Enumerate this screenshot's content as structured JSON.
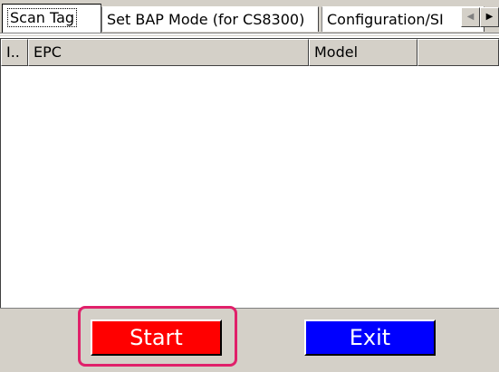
{
  "tabs": [
    {
      "label": "Scan Tag",
      "active": true
    },
    {
      "label": "Set BAP Mode (for CS8300)",
      "active": false
    },
    {
      "label": "Configuration/SI",
      "active": false
    }
  ],
  "tab_scroll": {
    "left_glyph": "◀",
    "right_glyph": "▶"
  },
  "list": {
    "columns": [
      "I..",
      "EPC",
      "Model",
      ""
    ],
    "rows": []
  },
  "buttons": {
    "start_label": "Start",
    "exit_label": "Exit"
  },
  "colors": {
    "start_bg": "#ff0000",
    "exit_bg": "#0000ff",
    "highlight": "#e0206a",
    "chrome": "#d4d0c8"
  }
}
